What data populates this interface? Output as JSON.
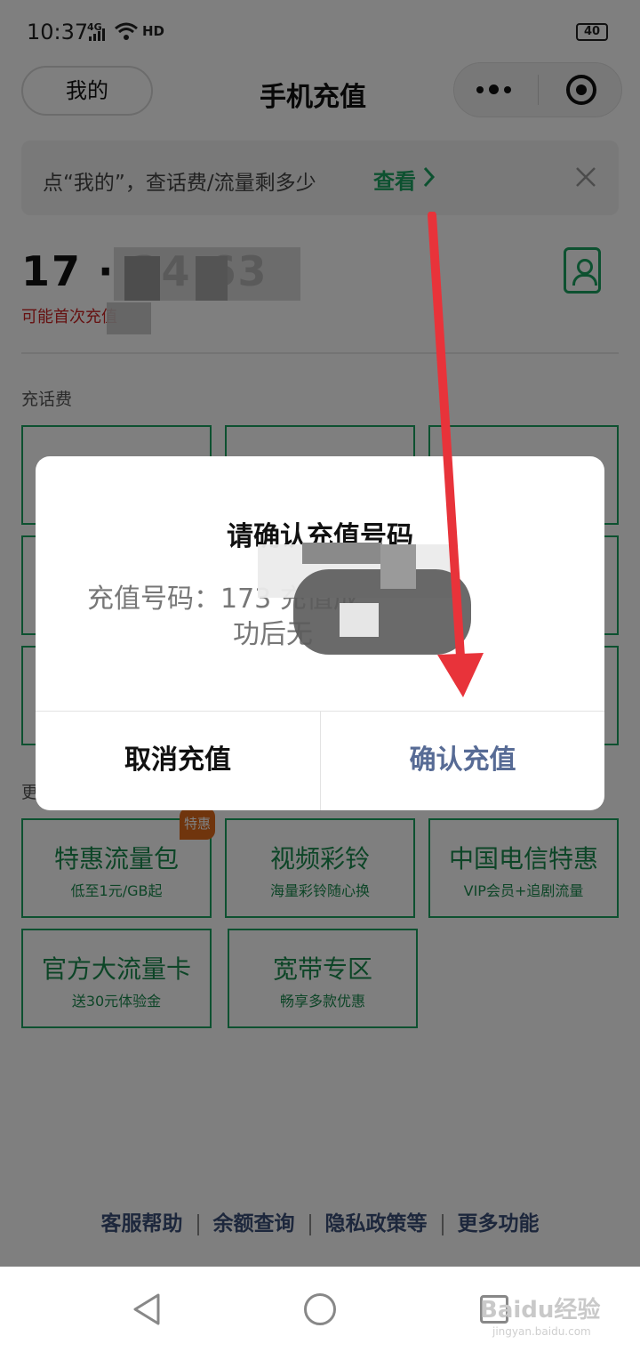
{
  "status_bar": {
    "time": "10:37",
    "network": "4G",
    "hd": "HD",
    "battery": "40"
  },
  "nav": {
    "me_label": "我的",
    "title": "手机充值"
  },
  "notice": {
    "text": "点“我的”，查话费/流量剩多少",
    "link": "查看"
  },
  "phone": {
    "number": "17  ·  34 63",
    "hint": "可能首次充值"
  },
  "sections": {
    "recharge_label": "充话费",
    "more_label": "更"
  },
  "cards": [
    {
      "title": "特惠流量包",
      "subtitle": "低至1元/GB起"
    },
    {
      "title": "视频彩铃",
      "subtitle": "海量彩铃随心换"
    },
    {
      "title": "中国电信特惠",
      "subtitle": "VIP会员+追剧流量"
    },
    {
      "title": "官方大流量卡",
      "subtitle": "送30元体验金"
    },
    {
      "title": "宽带专区",
      "subtitle": "畅享多款优惠"
    }
  ],
  "badge": "特惠",
  "footer": {
    "links": [
      "客服帮助",
      "余额查询",
      "隐私政策等",
      "更多功能"
    ]
  },
  "dialog": {
    "title": "请确认充值号码",
    "message_line1": "充值号码：173           充值成",
    "message_line2": "功后无",
    "cancel_label": "取消充值",
    "confirm_label": "确认充值"
  },
  "watermark": {
    "brand": "Baidu经验",
    "url": "jingyan.baidu.com"
  },
  "colors": {
    "accent_green": "#1aa260",
    "dialog_link": "#576b95",
    "arrow_red": "#e8333a",
    "badge_orange": "#e06a1b"
  },
  "icons": [
    "signal-icon",
    "wifi-icon",
    "battery-icon",
    "more-icon",
    "target-icon",
    "chevron-right-icon",
    "close-icon",
    "contacts-icon",
    "back-icon",
    "home-icon",
    "recent-apps-icon"
  ]
}
